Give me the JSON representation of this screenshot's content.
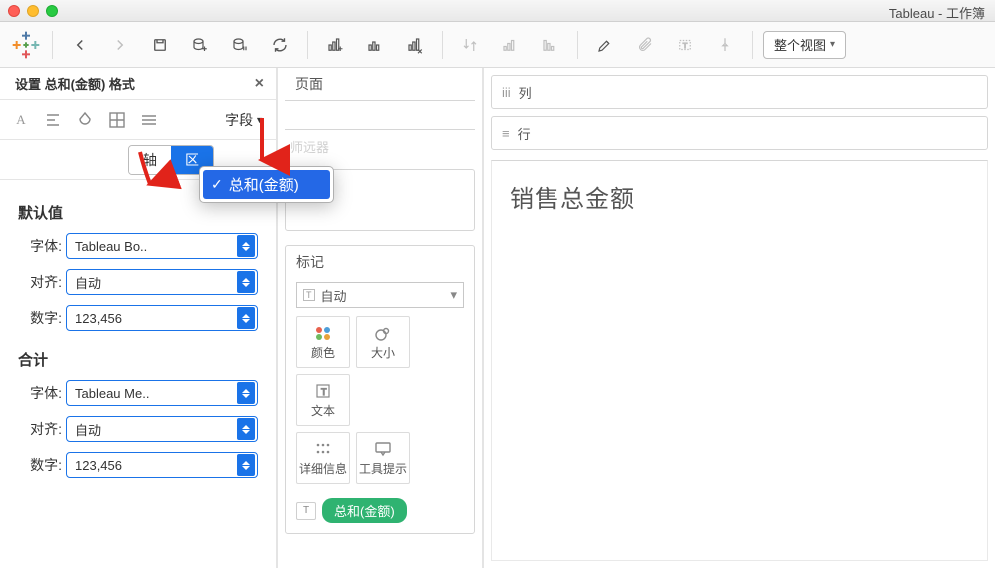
{
  "window": {
    "title": "Tableau - 工作簿"
  },
  "toolbar": {
    "fit_button": "整个视图"
  },
  "format_panel": {
    "title": "设置 总和(金额) 格式",
    "field_label": "字段",
    "tabs": {
      "axis": "轴",
      "pane": "区"
    },
    "defaults_label": "默认值",
    "total_label": "合计",
    "rows": {
      "font_label": "字体:",
      "align_label": "对齐:",
      "number_label": "数字:",
      "font_value_default": "Tableau Bo..",
      "align_value": "自动",
      "number_value": "123,456",
      "font_value_total": "Tableau Me.."
    }
  },
  "field_menu": {
    "item": "总和(金额)"
  },
  "shelves": {
    "pages": "页面",
    "filters_hidden": "筛选器",
    "marks": "标记",
    "mark_type_text": "自动",
    "color": "颜色",
    "size": "大小",
    "text": "文本",
    "detail": "详细信息",
    "tooltip": "工具提示"
  },
  "pill": {
    "sum_amount": "总和(金额)"
  },
  "right": {
    "columns": "列",
    "rows": "行",
    "viz_title": "销售总金额"
  }
}
